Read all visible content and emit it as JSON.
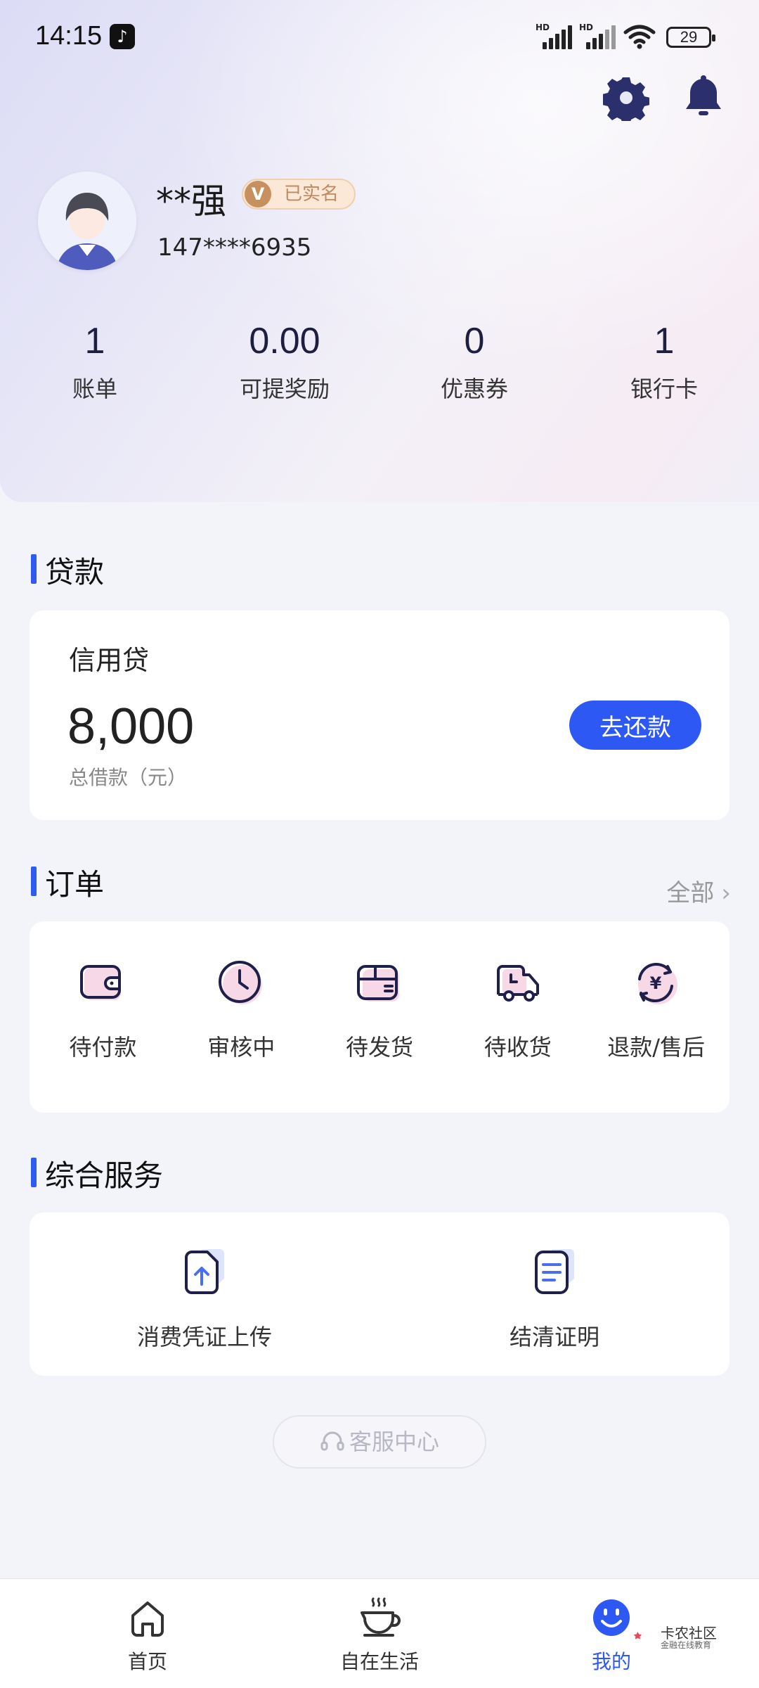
{
  "status_bar": {
    "time": "14:15",
    "battery": "29",
    "signal_labels": [
      "HD",
      "HD"
    ]
  },
  "profile": {
    "name": "**强",
    "verified_badge": "已实名",
    "verified_badge_letter": "V",
    "phone": "147****6935"
  },
  "stats": [
    {
      "value": "1",
      "label": "账单"
    },
    {
      "value": "0.00",
      "label": "可提奖励"
    },
    {
      "value": "0",
      "label": "优惠券"
    },
    {
      "value": "1",
      "label": "银行卡"
    }
  ],
  "loan_section": {
    "title": "贷款",
    "product_name": "信用贷",
    "amount": "8,000",
    "amount_label": "总借款（元）",
    "repay_button": "去还款"
  },
  "order_section": {
    "title": "订单",
    "view_all": "全部",
    "items": [
      {
        "label": "待付款",
        "icon": "wallet-icon"
      },
      {
        "label": "审核中",
        "icon": "clock-icon"
      },
      {
        "label": "待发货",
        "icon": "package-icon"
      },
      {
        "label": "待收货",
        "icon": "truck-icon"
      },
      {
        "label": "退款/售后",
        "icon": "refund-icon"
      }
    ]
  },
  "service_section": {
    "title": "综合服务",
    "items": [
      {
        "label": "消费凭证上传",
        "icon": "upload-document-icon"
      },
      {
        "label": "结清证明",
        "icon": "certificate-document-icon"
      }
    ]
  },
  "customer_service": {
    "label": "客服中心",
    "icon": "headset-icon"
  },
  "bottom_nav": [
    {
      "label": "首页",
      "icon": "home-icon",
      "active": false
    },
    {
      "label": "自在生活",
      "icon": "coffee-cup-icon",
      "active": false
    },
    {
      "label": "我的",
      "icon": "smiley-icon",
      "active": true
    }
  ],
  "watermark": {
    "title": "卡农社区",
    "subtitle": "金融在线教育"
  },
  "colors": {
    "accent": "#2e58f3",
    "badge_bg": "#fbe8d6",
    "badge_text": "#c08a60",
    "icon_pink": "#f4d6e4",
    "icon_dark": "#1f1f4a"
  }
}
